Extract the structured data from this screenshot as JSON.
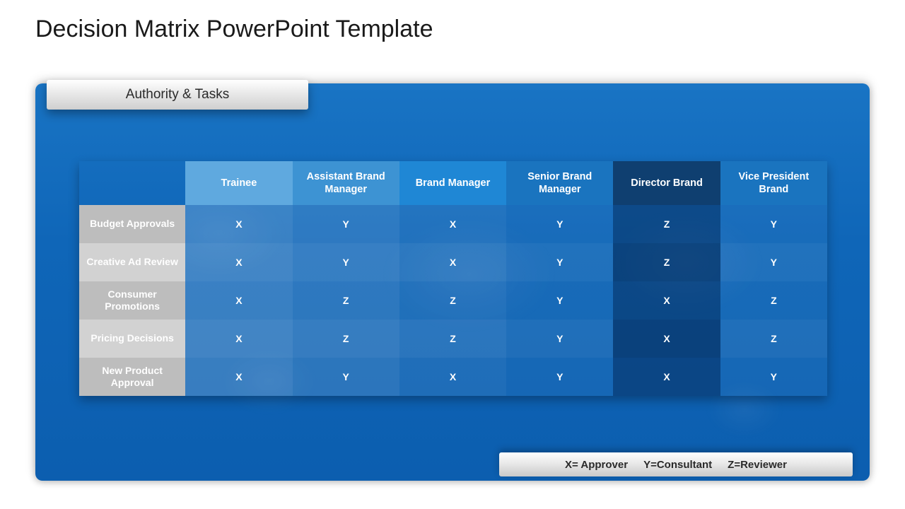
{
  "title": "Decision Matrix PowerPoint Template",
  "section_label": "Authority & Tasks",
  "columns": [
    {
      "label": "Trainee"
    },
    {
      "label": "Assistant Brand Manager"
    },
    {
      "label": "Brand Manager"
    },
    {
      "label": "Senior Brand Manager"
    },
    {
      "label": "Director Brand"
    },
    {
      "label": "Vice President Brand"
    }
  ],
  "rows": [
    {
      "label": "Budget Approvals",
      "cells": [
        "X",
        "Y",
        "X",
        "Y",
        "Z",
        "Y"
      ]
    },
    {
      "label": "Creative Ad Review",
      "cells": [
        "X",
        "Y",
        "X",
        "Y",
        "Z",
        "Y"
      ]
    },
    {
      "label": "Consumer Promotions",
      "cells": [
        "X",
        "Z",
        "Z",
        "Y",
        "X",
        "Z"
      ]
    },
    {
      "label": "Pricing Decisions",
      "cells": [
        "X",
        "Z",
        "Z",
        "Y",
        "X",
        "Z"
      ]
    },
    {
      "label": "New Product Approval",
      "cells": [
        "X",
        "Y",
        "X",
        "Y",
        "X",
        "Y"
      ]
    }
  ],
  "legend": {
    "x": "X= Approver",
    "y": "Y=Consultant",
    "z": "Z=Reviewer"
  },
  "chart_data": {
    "type": "table",
    "title": "Authority & Tasks",
    "columns": [
      "Trainee",
      "Assistant Brand Manager",
      "Brand Manager",
      "Senior Brand Manager",
      "Director Brand",
      "Vice President Brand"
    ],
    "rows": [
      "Budget Approvals",
      "Creative Ad Review",
      "Consumer Promotions",
      "Pricing Decisions",
      "New Product Approval"
    ],
    "values": [
      [
        "X",
        "Y",
        "X",
        "Y",
        "Z",
        "Y"
      ],
      [
        "X",
        "Y",
        "X",
        "Y",
        "Z",
        "Y"
      ],
      [
        "X",
        "Z",
        "Z",
        "Y",
        "X",
        "Z"
      ],
      [
        "X",
        "Z",
        "Z",
        "Y",
        "X",
        "Z"
      ],
      [
        "X",
        "Y",
        "X",
        "Y",
        "X",
        "Y"
      ]
    ],
    "legend": {
      "X": "Approver",
      "Y": "Consultant",
      "Z": "Reviewer"
    }
  }
}
